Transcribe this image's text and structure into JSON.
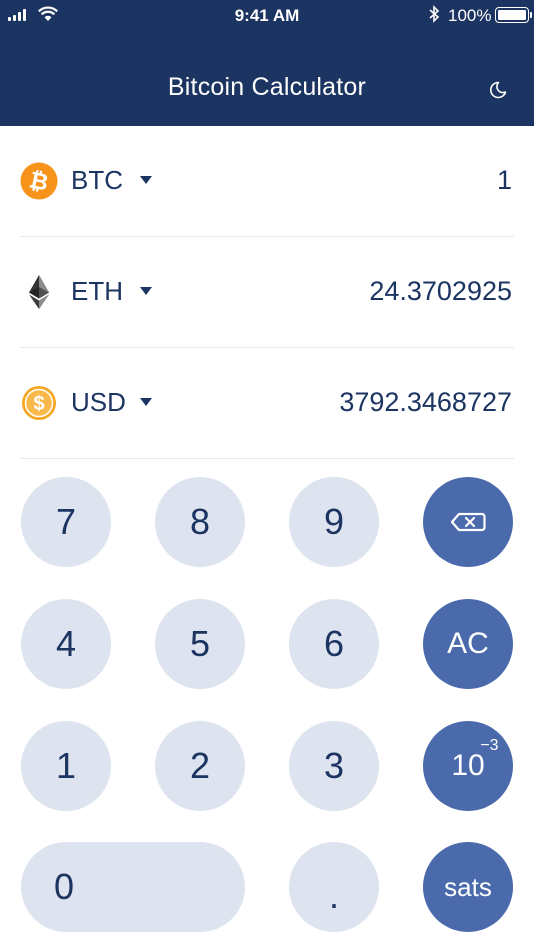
{
  "status_bar": {
    "time": "9:41 AM",
    "battery": "100%"
  },
  "header": {
    "title": "Bitcoin Calculator",
    "theme_icon": "moon-icon"
  },
  "currencies": [
    {
      "code": "BTC",
      "amount": "1",
      "icon": "bitcoin-icon",
      "color": "#f7931a"
    },
    {
      "code": "ETH",
      "amount": "24.3702925",
      "icon": "ethereum-icon",
      "color": "#343434"
    },
    {
      "code": "USD",
      "amount": "3792.3468727",
      "icon": "dollar-icon",
      "color": "#f5a623"
    }
  ],
  "keypad": {
    "k7": "7",
    "k8": "8",
    "k9": "9",
    "k4": "4",
    "k5": "5",
    "k6": "6",
    "k1": "1",
    "k2": "2",
    "k3": "3",
    "k0": "0",
    "dot": ".",
    "backspace_icon": "backspace-icon",
    "clear": "AC",
    "exp_base": "10",
    "exp_power": "−3",
    "sats": "sats"
  },
  "colors": {
    "header": "#1c3461",
    "key": "#dde3ef",
    "key_action": "#4a6aac",
    "text": "#1c3461"
  }
}
